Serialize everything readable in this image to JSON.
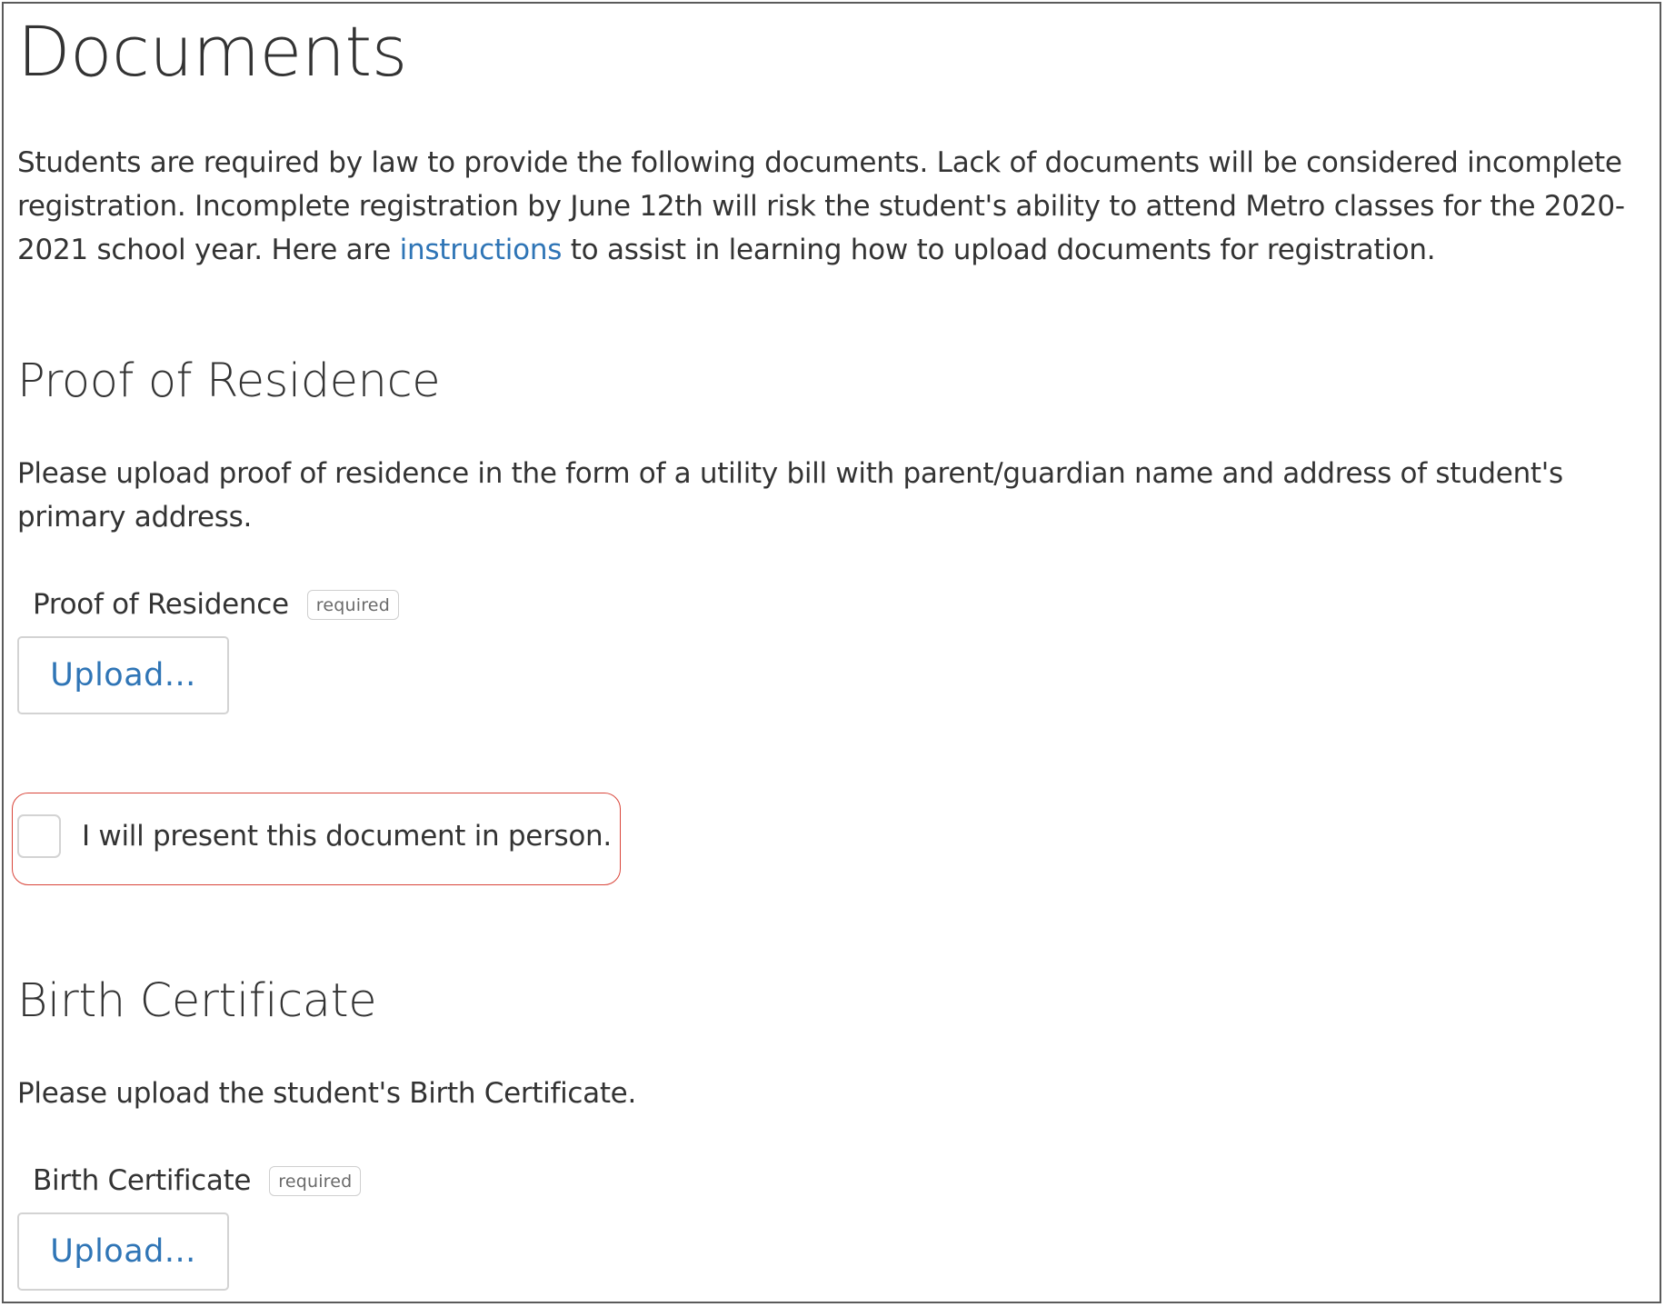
{
  "page": {
    "title": "Documents",
    "intro": {
      "before_link": "Students are required by law to provide the following documents. Lack of documents will be considered incomplete registration. Incomplete registration by June 12th will risk the student's ability to attend Metro classes for the 2020-2021 school year. Here are ",
      "link_text": "instructions",
      "after_link": " to assist in learning how to upload documents for registration."
    }
  },
  "sections": {
    "residence": {
      "heading": "Proof of Residence",
      "description": "Please upload proof of residence in the form of a utility bill with parent/guardian name and address of student's primary address.",
      "field_label": "Proof of Residence",
      "required_badge": "required",
      "upload_label": "Upload...",
      "in_person_checkbox": {
        "label": "I will present this document in person.",
        "checked": false
      }
    },
    "birth": {
      "heading": "Birth Certificate",
      "description": "Please upload the student's Birth Certificate.",
      "field_label": "Birth Certificate",
      "required_badge": "required",
      "upload_label": "Upload..."
    }
  },
  "colors": {
    "text": "#333333",
    "link": "#2f75b6",
    "highlight_border": "#d9453a",
    "control_border": "#d3d3d3"
  }
}
